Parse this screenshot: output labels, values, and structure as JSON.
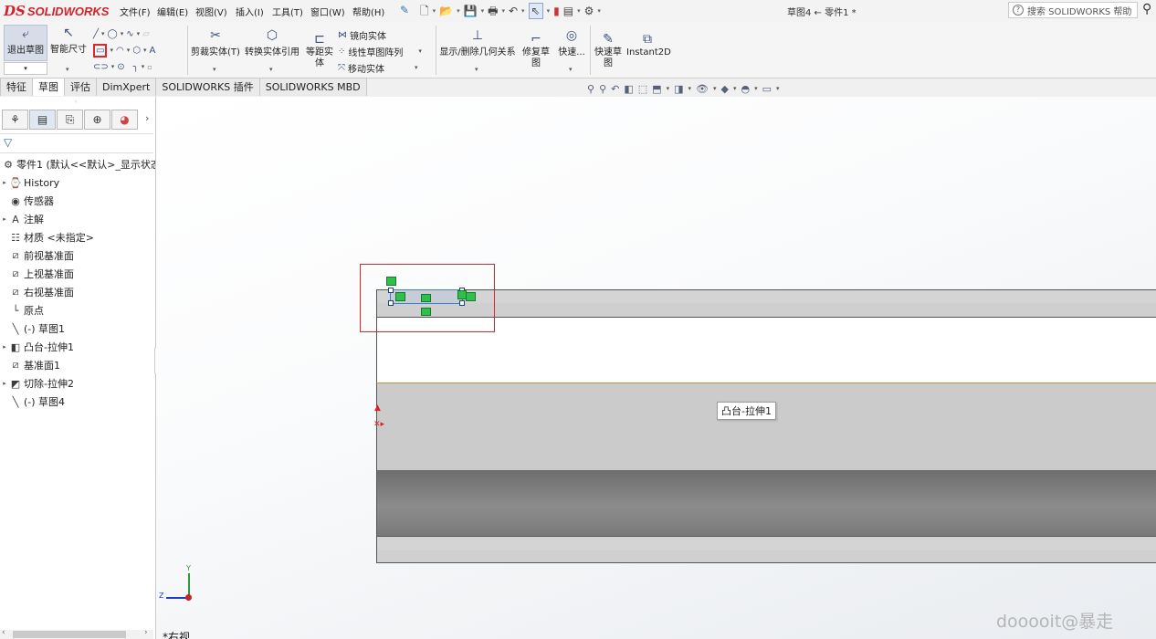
{
  "app": {
    "brand_ds": "DS",
    "brand_name": "SOLIDWORKS"
  },
  "menu": [
    "文件(F)",
    "编辑(E)",
    "视图(V)",
    "插入(I)",
    "工具(T)",
    "窗口(W)",
    "帮助(H)"
  ],
  "doc_title": "草图4 ← 零件1 *",
  "help_search": {
    "placeholder": "搜索 SOLIDWORKS 帮助"
  },
  "ribbon": {
    "exit_sketch": "退出草图",
    "smart_dim": "智能尺寸",
    "trim": "剪裁实体(T)",
    "convert": "转换实体引用",
    "offset_l1": "等距实",
    "offset_l2": "体",
    "mirror": "镜向实体",
    "linear_pattern": "线性草图阵列",
    "move": "移动实体",
    "relations": "显示/删除几何关系",
    "repair_l1": "修复草",
    "repair_l2": "图",
    "quick_snap": "快速...",
    "quick_sketch_l1": "快速草",
    "quick_sketch_l2": "图",
    "instant2d": "Instant2D"
  },
  "tabs": [
    "特征",
    "草图",
    "评估",
    "DimXpert",
    "SOLIDWORKS 插件",
    "SOLIDWORKS MBD"
  ],
  "active_tab": 1,
  "tree": [
    {
      "label": "零件1  (默认<<默认>_显示状态",
      "icon": "part-icon",
      "expand": ""
    },
    {
      "label": "History",
      "icon": "history-icon",
      "expand": "▸"
    },
    {
      "label": "传感器",
      "icon": "sensor-icon",
      "expand": ""
    },
    {
      "label": "注解",
      "icon": "annotation-icon",
      "expand": "▸"
    },
    {
      "label": "材质 <未指定>",
      "icon": "material-icon",
      "expand": ""
    },
    {
      "label": "前视基准面",
      "icon": "plane-icon",
      "expand": ""
    },
    {
      "label": "上视基准面",
      "icon": "plane-icon",
      "expand": ""
    },
    {
      "label": "右视基准面",
      "icon": "plane-icon",
      "expand": ""
    },
    {
      "label": "原点",
      "icon": "origin-icon",
      "expand": ""
    },
    {
      "label": "(-) 草图1",
      "icon": "sketch-icon",
      "expand": ""
    },
    {
      "label": "凸台-拉伸1",
      "icon": "extrude-icon",
      "expand": "▸"
    },
    {
      "label": "基准面1",
      "icon": "plane-icon",
      "expand": ""
    },
    {
      "label": "切除-拉伸2",
      "icon": "cut-extrude-icon",
      "expand": "▸"
    },
    {
      "label": "(-) 草图4",
      "icon": "sketch-icon",
      "expand": ""
    }
  ],
  "tooltip": "凸台-拉伸1",
  "view_name": "*右视",
  "triad": {
    "y": "Y",
    "z": "Z"
  },
  "watermark": "dooooit@暴走",
  "colors": {
    "accent": "#d2222a",
    "highlight_box": "#e0262b",
    "relation_green": "#2fbf4a",
    "selection_blue": "#3f7fd0"
  }
}
